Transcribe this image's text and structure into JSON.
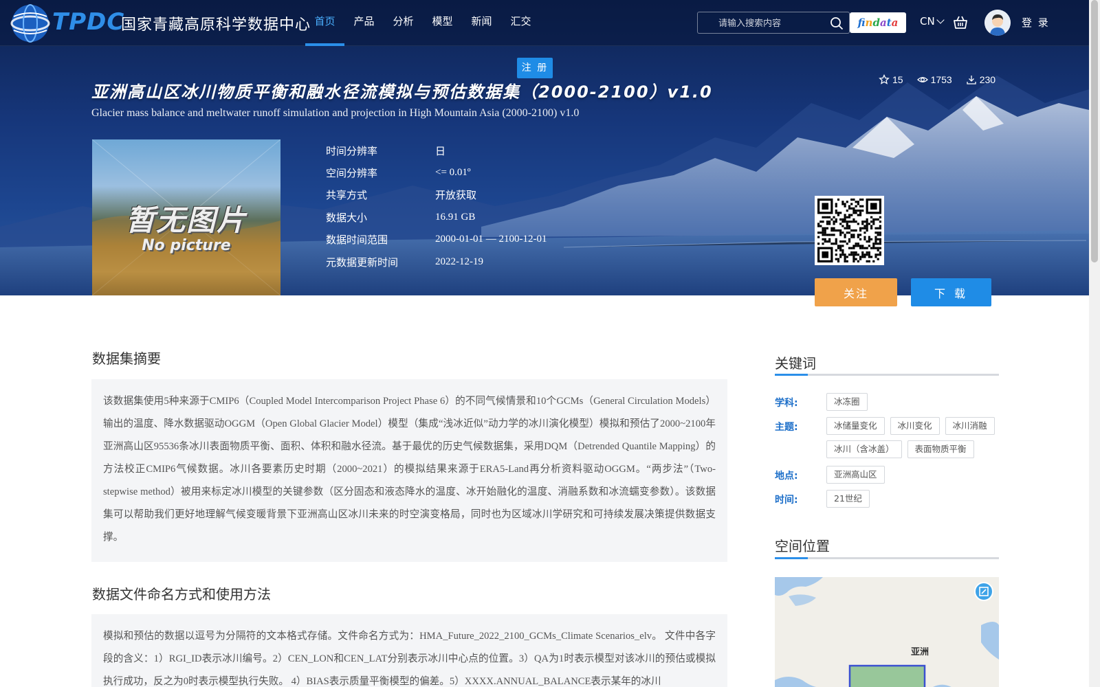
{
  "header": {
    "logo_abbr": "TPDC",
    "logo_name": "国家青藏高原科学数据中心",
    "nav": [
      {
        "label": "首页",
        "active": true
      },
      {
        "label": "产品"
      },
      {
        "label": "分析"
      },
      {
        "label": "模型"
      },
      {
        "label": "新闻"
      },
      {
        "label": "汇交"
      }
    ],
    "search_placeholder": "请输入搜索内容",
    "findata_letters": [
      "f",
      "i",
      "n",
      "d",
      "a",
      "t",
      "a"
    ],
    "language": "CN",
    "login_label": "登 录",
    "register_label": "注 册"
  },
  "dataset": {
    "title_cn": "亚洲高山区冰川物质平衡和融水径流模拟与预估数据集（2000-2100）v1.0",
    "title_en": "Glacier mass balance and meltwater runoff simulation and projection in High Mountain Asia (2000-2100) v1.0",
    "stats": {
      "favorites": "15",
      "views": "1753",
      "downloads": "230"
    },
    "thumbnail_text_cn": "暂无图片",
    "thumbnail_text_en": "No picture",
    "meta": [
      {
        "key": "时间分辨率",
        "value": "日"
      },
      {
        "key": "空间分辨率",
        "value": "<= 0.01º"
      },
      {
        "key": "共享方式",
        "value": "开放获取"
      },
      {
        "key": "数据大小",
        "value": "16.91 GB"
      },
      {
        "key": "数据时间范围",
        "value": "2000-01-01 — 2100-12-01"
      },
      {
        "key": "元数据更新时间",
        "value": "2022-12-19"
      }
    ],
    "follow_label": "关注",
    "download_label": "下 载"
  },
  "main": {
    "abstract_title": "数据集摘要",
    "abstract": "该数据集使用5种来源于CMIP6（Coupled Model Intercomparison Project Phase 6）的不同气候情景和10个GCMs（General Circulation Models）输出的温度、降水数据驱动OGGM（Open Global Glacier Model）模型（集成“浅冰近似”动力学的冰川演化模型）模拟和预估了2000~2100年亚洲高山区95536条冰川表面物质平衡、面积、体积和融水径流。基于最优的历史气候数据集，采用DQM（Detrended Quantile Mapping）的方法校正CMIP6气候数据。冰川各要素历史时期（2000~2021）的模拟结果来源于ERA5-Land再分析资料驱动OGGM。“两步法”（Two-stepwise method）被用来标定冰川模型的关键参数（区分固态和液态降水的温度、冰开始融化的温度、消融系数和冰流蠕变参数）。该数据集可以帮助我们更好地理解气候变暖背景下亚洲高山区冰川未来的时空演变格局，同时也为区域冰川学研究和可持续发展决策提供数据支撑。",
    "naming_title": "数据文件命名方式和使用方法",
    "naming": "模拟和预估的数据以逗号为分隔符的文本格式存储。文件命名方式为：HMA_Future_2022_2100_GCMs_Climate Scenarios_elv。 文件中各字段的含义：1）RGI_ID表示冰川编号。2）CEN_LON和CEN_LAT分别表示冰川中心点的位置。3）QA为1时表示模型对该冰川的预估或模拟执行成功，反之为0时表示模型执行失败。 4）BIAS表示质量平衡模型的偏差。5）XXXX.ANNUAL_BALANCE表示某年的冰川"
  },
  "sidebar": {
    "keywords_title": "关键词",
    "keyword_groups": [
      {
        "label": "学科:",
        "tags": [
          "冰冻圈"
        ]
      },
      {
        "label": "主题:",
        "tags": [
          "冰储量变化",
          "冰川变化",
          "冰川消融",
          "冰川（含冰盖）",
          "表面物质平衡"
        ]
      },
      {
        "label": "地点:",
        "tags": [
          "亚洲高山区"
        ]
      },
      {
        "label": "时间:",
        "tags": [
          "21世纪"
        ]
      }
    ],
    "location_title": "空间位置",
    "map_label": "亚洲"
  }
}
